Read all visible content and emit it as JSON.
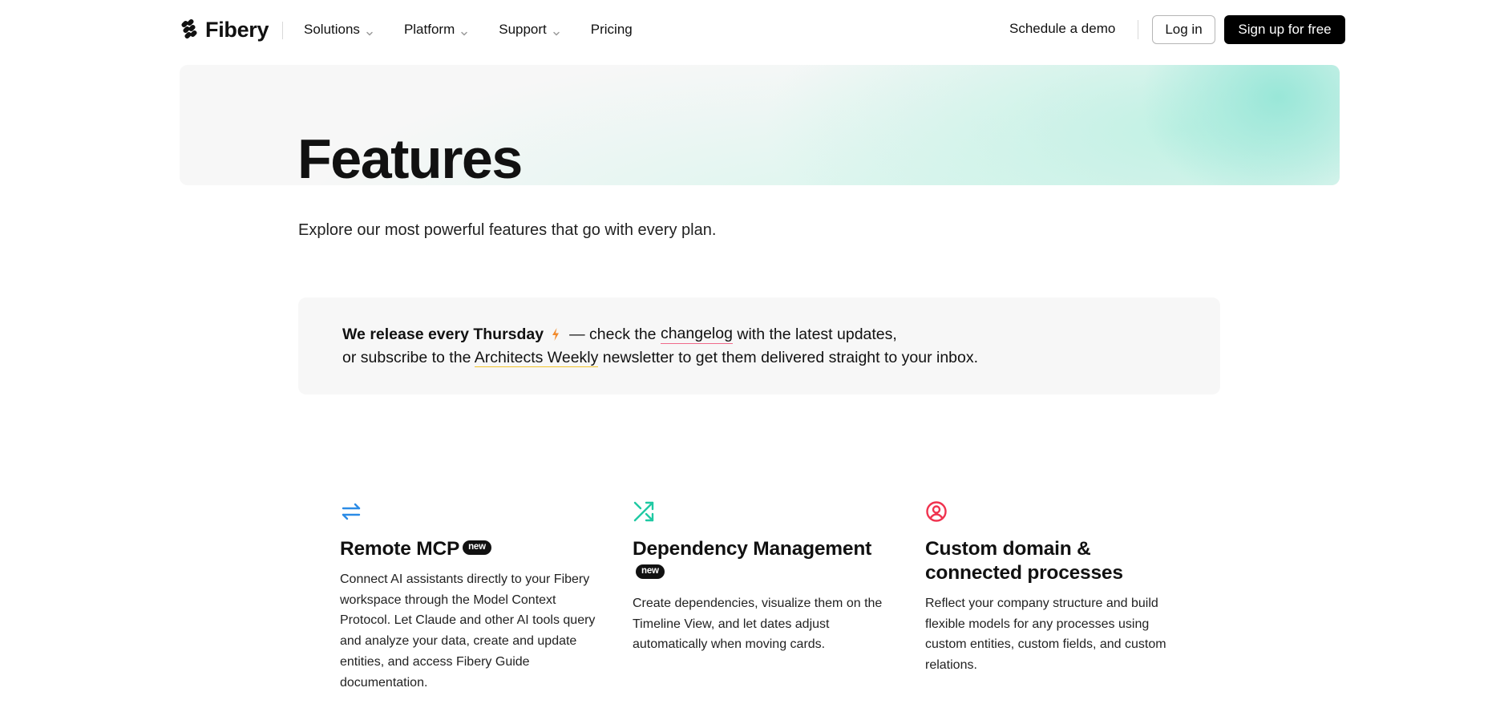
{
  "header": {
    "logo_text": "Fibery",
    "nav": [
      {
        "label": "Solutions",
        "has_dropdown": true
      },
      {
        "label": "Platform",
        "has_dropdown": true
      },
      {
        "label": "Support",
        "has_dropdown": true
      },
      {
        "label": "Pricing",
        "has_dropdown": false
      }
    ],
    "demo_label": "Schedule a demo",
    "login_label": "Log in",
    "signup_label": "Sign up for free"
  },
  "hero": {
    "title": "Features",
    "subtitle": "Explore our most powerful features that go with every plan."
  },
  "release": {
    "bold_text": "We release every Thursday",
    "line1_after_icon": "— check the",
    "changelog_link": "changelog",
    "line1_end": "with the latest updates,",
    "line2_start": "or subscribe to the",
    "newsletter_link": "Architects Weekly",
    "line2_end": "newsletter to get them delivered straight to your inbox."
  },
  "features": [
    {
      "icon": "arrows-exchange-icon",
      "icon_color": "#2b8be6",
      "title": "Remote MCP",
      "badge": "new",
      "description": "Connect AI assistants directly to your Fibery workspace through the Model Context Protocol. Let Claude and other AI tools query and analyze your data, create and update entities, and access Fibery Guide documentation."
    },
    {
      "icon": "shuffle-arrows-icon",
      "icon_color": "#1fc9a3",
      "title": "Dependency Management",
      "badge": "new",
      "description": "Create dependencies, visualize them on the Timeline View, and let dates adjust automatically when moving cards."
    },
    {
      "icon": "user-circle-icon",
      "icon_color": "#f0334f",
      "title": "Custom domain & connected processes",
      "badge": "",
      "description": "Reflect your company structure and build flexible models for any processes using custom entities, custom fields, and custom relations."
    }
  ],
  "colors": {
    "accent_black": "#000000",
    "changelog_underline": "#f06a8a",
    "newsletter_underline": "#f2c22a",
    "hero_gradient": "#b9f0e1"
  }
}
